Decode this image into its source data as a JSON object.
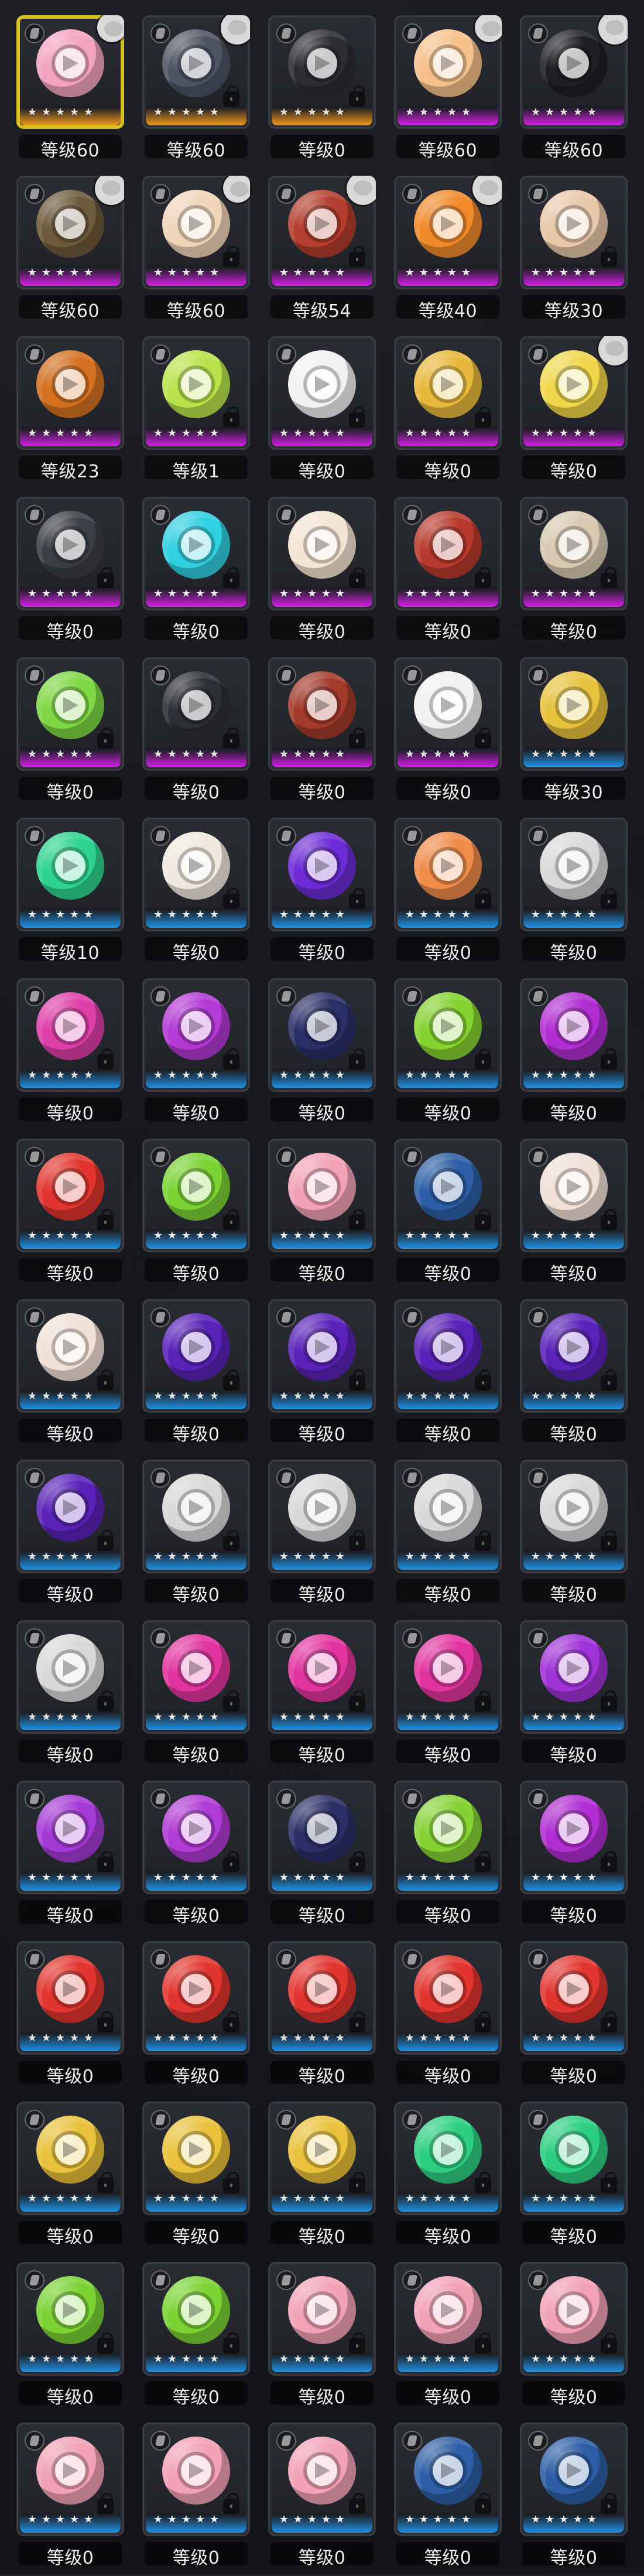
{
  "grid": {
    "columns": 5,
    "items": [
      {
        "level_text": "等级60",
        "tier_color": "#f39a1c",
        "ball_color": "#f3a3bf",
        "has_portrait": true,
        "locked": false,
        "selected": true,
        "stars": 5
      },
      {
        "level_text": "等级60",
        "tier_color": "#f39a1c",
        "ball_color": "#4d5563",
        "has_portrait": true,
        "locked": true,
        "selected": false,
        "stars": 5
      },
      {
        "level_text": "等级0",
        "tier_color": "#f39a1c",
        "ball_color": "#2b2d33",
        "has_portrait": false,
        "locked": true,
        "selected": false,
        "stars": 5
      },
      {
        "level_text": "等级60",
        "tier_color": "#d51ee8",
        "ball_color": "#f6c08b",
        "has_portrait": true,
        "locked": false,
        "selected": false,
        "stars": 5
      },
      {
        "level_text": "等级60",
        "tier_color": "#d51ee8",
        "ball_color": "#1e1f23",
        "has_portrait": true,
        "locked": false,
        "selected": false,
        "stars": 5
      },
      {
        "level_text": "等级60",
        "tier_color": "#d51ee8",
        "ball_color": "#6c5a3a",
        "has_portrait": true,
        "locked": false,
        "selected": false,
        "stars": 5
      },
      {
        "level_text": "等级60",
        "tier_color": "#d51ee8",
        "ball_color": "#f0d4b8",
        "has_portrait": true,
        "locked": true,
        "selected": false,
        "stars": 5
      },
      {
        "level_text": "等级54",
        "tier_color": "#d51ee8",
        "ball_color": "#b33d2e",
        "has_portrait": true,
        "locked": true,
        "selected": false,
        "stars": 5
      },
      {
        "level_text": "等级40",
        "tier_color": "#d51ee8",
        "ball_color": "#f08a2b",
        "has_portrait": true,
        "locked": false,
        "selected": false,
        "stars": 5
      },
      {
        "level_text": "等级30",
        "tier_color": "#d51ee8",
        "ball_color": "#e9c7a9",
        "has_portrait": false,
        "locked": true,
        "selected": false,
        "stars": 5
      },
      {
        "level_text": "等级23",
        "tier_color": "#d51ee8",
        "ball_color": "#d47020",
        "has_portrait": false,
        "locked": false,
        "selected": false,
        "stars": 5
      },
      {
        "level_text": "等级1",
        "tier_color": "#d51ee8",
        "ball_color": "#b9e24a",
        "has_portrait": false,
        "locked": true,
        "selected": false,
        "stars": 5
      },
      {
        "level_text": "等级0",
        "tier_color": "#d51ee8",
        "ball_color": "#f1f1f1",
        "has_portrait": false,
        "locked": true,
        "selected": false,
        "stars": 5
      },
      {
        "level_text": "等级0",
        "tier_color": "#d51ee8",
        "ball_color": "#e7b83b",
        "has_portrait": false,
        "locked": true,
        "selected": false,
        "stars": 5
      },
      {
        "level_text": "等级0",
        "tier_color": "#d51ee8",
        "ball_color": "#f0d64a",
        "has_portrait": true,
        "locked": false,
        "selected": false,
        "stars": 5
      },
      {
        "level_text": "等级0",
        "tier_color": "#d51ee8",
        "ball_color": "#3b3e45",
        "has_portrait": false,
        "locked": true,
        "selected": false,
        "stars": 5
      },
      {
        "level_text": "等级0",
        "tier_color": "#d51ee8",
        "ball_color": "#2fd0e0",
        "has_portrait": false,
        "locked": true,
        "selected": false,
        "stars": 5
      },
      {
        "level_text": "等级0",
        "tier_color": "#d51ee8",
        "ball_color": "#f4e4d3",
        "has_portrait": false,
        "locked": true,
        "selected": false,
        "stars": 5
      },
      {
        "level_text": "等级0",
        "tier_color": "#d51ee8",
        "ball_color": "#b83a2e",
        "has_portrait": false,
        "locked": true,
        "selected": false,
        "stars": 5
      },
      {
        "level_text": "等级0",
        "tier_color": "#d51ee8",
        "ball_color": "#d8c8b0",
        "has_portrait": false,
        "locked": true,
        "selected": false,
        "stars": 5
      },
      {
        "level_text": "等级0",
        "tier_color": "#d51ee8",
        "ball_color": "#7ed744",
        "has_portrait": false,
        "locked": true,
        "selected": false,
        "stars": 5
      },
      {
        "level_text": "等级0",
        "tier_color": "#d51ee8",
        "ball_color": "#2c2f36",
        "has_portrait": false,
        "locked": true,
        "selected": false,
        "stars": 5
      },
      {
        "level_text": "等级0",
        "tier_color": "#d51ee8",
        "ball_color": "#a23a2b",
        "has_portrait": false,
        "locked": true,
        "selected": false,
        "stars": 5
      },
      {
        "level_text": "等级0",
        "tier_color": "#d51ee8",
        "ball_color": "#f1f1f1",
        "has_portrait": false,
        "locked": true,
        "selected": false,
        "stars": 5
      },
      {
        "level_text": "等级30",
        "tier_color": "#1f92e6",
        "ball_color": "#e7c23d",
        "has_portrait": false,
        "locked": false,
        "selected": false,
        "stars": 5
      },
      {
        "level_text": "等级10",
        "tier_color": "#1f92e6",
        "ball_color": "#2ed38f",
        "has_portrait": false,
        "locked": false,
        "selected": false,
        "stars": 5
      },
      {
        "level_text": "等级0",
        "tier_color": "#1f92e6",
        "ball_color": "#f0e8de",
        "has_portrait": false,
        "locked": true,
        "selected": false,
        "stars": 5
      },
      {
        "level_text": "等级0",
        "tier_color": "#1f92e6",
        "ball_color": "#6d2bd5",
        "has_portrait": false,
        "locked": true,
        "selected": false,
        "stars": 5
      },
      {
        "level_text": "等级0",
        "tier_color": "#1f92e6",
        "ball_color": "#f08b4a",
        "has_portrait": false,
        "locked": true,
        "selected": false,
        "stars": 5
      },
      {
        "level_text": "等级0",
        "tier_color": "#1f92e6",
        "ball_color": "#d9d9d9",
        "has_portrait": false,
        "locked": true,
        "selected": false,
        "stars": 5
      },
      {
        "level_text": "等级0",
        "tier_color": "#1f92e6",
        "ball_color": "#de3ea8",
        "has_portrait": false,
        "locked": true,
        "selected": false,
        "stars": 5
      },
      {
        "level_text": "等级0",
        "tier_color": "#1f92e6",
        "ball_color": "#b33ad4",
        "has_portrait": false,
        "locked": true,
        "selected": false,
        "stars": 5
      },
      {
        "level_text": "等级0",
        "tier_color": "#1f92e6",
        "ball_color": "#2a2f67",
        "has_portrait": false,
        "locked": true,
        "selected": false,
        "stars": 5
      },
      {
        "level_text": "等级0",
        "tier_color": "#1f92e6",
        "ball_color": "#85d230",
        "has_portrait": false,
        "locked": true,
        "selected": false,
        "stars": 5
      },
      {
        "level_text": "等级0",
        "tier_color": "#1f92e6",
        "ball_color": "#b12ed2",
        "has_portrait": false,
        "locked": true,
        "selected": false,
        "stars": 5
      },
      {
        "level_text": "等级0",
        "tier_color": "#1f92e6",
        "ball_color": "#e2352f",
        "has_portrait": false,
        "locked": true,
        "selected": false,
        "stars": 5
      },
      {
        "level_text": "等级0",
        "tier_color": "#1f92e6",
        "ball_color": "#7ad233",
        "has_portrait": false,
        "locked": true,
        "selected": false,
        "stars": 5
      },
      {
        "level_text": "等级0",
        "tier_color": "#1f92e6",
        "ball_color": "#f2a1b6",
        "has_portrait": false,
        "locked": true,
        "selected": false,
        "stars": 5
      },
      {
        "level_text": "等级0",
        "tier_color": "#1f92e6",
        "ball_color": "#2d5ea5",
        "has_portrait": false,
        "locked": true,
        "selected": false,
        "stars": 5
      },
      {
        "level_text": "等级0",
        "tier_color": "#1f92e6",
        "ball_color": "#f0e0d6",
        "has_portrait": false,
        "locked": true,
        "selected": false,
        "stars": 5
      },
      {
        "level_text": "等级0",
        "tier_color": "#1f92e6",
        "ball_color": "#f0e0d6",
        "has_portrait": false,
        "locked": true,
        "selected": false,
        "stars": 5
      },
      {
        "level_text": "等级0",
        "tier_color": "#1f92e6",
        "ball_color": "#5a22b8",
        "has_portrait": false,
        "locked": true,
        "selected": false,
        "stars": 5
      },
      {
        "level_text": "等级0",
        "tier_color": "#1f92e6",
        "ball_color": "#5a22b8",
        "has_portrait": false,
        "locked": true,
        "selected": false,
        "stars": 5
      },
      {
        "level_text": "等级0",
        "tier_color": "#1f92e6",
        "ball_color": "#5a22b8",
        "has_portrait": false,
        "locked": true,
        "selected": false,
        "stars": 5
      },
      {
        "level_text": "等级0",
        "tier_color": "#1f92e6",
        "ball_color": "#5a22b8",
        "has_portrait": false,
        "locked": true,
        "selected": false,
        "stars": 5
      },
      {
        "level_text": "等级0",
        "tier_color": "#1f92e6",
        "ball_color": "#5a22b8",
        "has_portrait": false,
        "locked": true,
        "selected": false,
        "stars": 5
      },
      {
        "level_text": "等级0",
        "tier_color": "#1f92e6",
        "ball_color": "#d8d8d8",
        "has_portrait": false,
        "locked": true,
        "selected": false,
        "stars": 5
      },
      {
        "level_text": "等级0",
        "tier_color": "#1f92e6",
        "ball_color": "#d8d8d8",
        "has_portrait": false,
        "locked": true,
        "selected": false,
        "stars": 5
      },
      {
        "level_text": "等级0",
        "tier_color": "#1f92e6",
        "ball_color": "#d8d8d8",
        "has_portrait": false,
        "locked": true,
        "selected": false,
        "stars": 5
      },
      {
        "level_text": "等级0",
        "tier_color": "#1f92e6",
        "ball_color": "#d8d8d8",
        "has_portrait": false,
        "locked": true,
        "selected": false,
        "stars": 5
      },
      {
        "level_text": "等级0",
        "tier_color": "#1f92e6",
        "ball_color": "#d8d8d8",
        "has_portrait": false,
        "locked": true,
        "selected": false,
        "stars": 5
      },
      {
        "level_text": "等级0",
        "tier_color": "#1f92e6",
        "ball_color": "#e2349f",
        "has_portrait": false,
        "locked": true,
        "selected": false,
        "stars": 5
      },
      {
        "level_text": "等级0",
        "tier_color": "#1f92e6",
        "ball_color": "#e2349f",
        "has_portrait": false,
        "locked": true,
        "selected": false,
        "stars": 5
      },
      {
        "level_text": "等级0",
        "tier_color": "#1f92e6",
        "ball_color": "#e2349f",
        "has_portrait": false,
        "locked": true,
        "selected": false,
        "stars": 5
      },
      {
        "level_text": "等级0",
        "tier_color": "#1f92e6",
        "ball_color": "#a032d8",
        "has_portrait": false,
        "locked": true,
        "selected": false,
        "stars": 5
      },
      {
        "level_text": "等级0",
        "tier_color": "#1f92e6",
        "ball_color": "#a43ad6",
        "has_portrait": false,
        "locked": true,
        "selected": false,
        "stars": 5
      },
      {
        "level_text": "等级0",
        "tier_color": "#1f92e6",
        "ball_color": "#b13bd5",
        "has_portrait": false,
        "locked": true,
        "selected": false,
        "stars": 5
      },
      {
        "level_text": "等级0",
        "tier_color": "#1f92e6",
        "ball_color": "#2a2f67",
        "has_portrait": false,
        "locked": true,
        "selected": false,
        "stars": 5
      },
      {
        "level_text": "等级0",
        "tier_color": "#1f92e6",
        "ball_color": "#86d235",
        "has_portrait": false,
        "locked": true,
        "selected": false,
        "stars": 5
      },
      {
        "level_text": "等级0",
        "tier_color": "#1f92e6",
        "ball_color": "#b12ed2",
        "has_portrait": false,
        "locked": true,
        "selected": false,
        "stars": 5
      },
      {
        "level_text": "等级0",
        "tier_color": "#1f92e6",
        "ball_color": "#e2352f",
        "has_portrait": false,
        "locked": true,
        "selected": false,
        "stars": 5
      },
      {
        "level_text": "等级0",
        "tier_color": "#1f92e6",
        "ball_color": "#e2352f",
        "has_portrait": false,
        "locked": true,
        "selected": false,
        "stars": 5
      },
      {
        "level_text": "等级0",
        "tier_color": "#1f92e6",
        "ball_color": "#e2352f",
        "has_portrait": false,
        "locked": true,
        "selected": false,
        "stars": 5
      },
      {
        "level_text": "等级0",
        "tier_color": "#1f92e6",
        "ball_color": "#e2352f",
        "has_portrait": false,
        "locked": true,
        "selected": false,
        "stars": 5
      },
      {
        "level_text": "等级0",
        "tier_color": "#1f92e6",
        "ball_color": "#e2352f",
        "has_portrait": false,
        "locked": true,
        "selected": false,
        "stars": 5
      },
      {
        "level_text": "等级0",
        "tier_color": "#1f92e6",
        "ball_color": "#e9c13a",
        "has_portrait": false,
        "locked": true,
        "selected": false,
        "stars": 5
      },
      {
        "level_text": "等级0",
        "tier_color": "#1f92e6",
        "ball_color": "#e9c13a",
        "has_portrait": false,
        "locked": true,
        "selected": false,
        "stars": 5
      },
      {
        "level_text": "等级0",
        "tier_color": "#1f92e6",
        "ball_color": "#e9c13a",
        "has_portrait": false,
        "locked": true,
        "selected": false,
        "stars": 5
      },
      {
        "level_text": "等级0",
        "tier_color": "#1f92e6",
        "ball_color": "#2ccf80",
        "has_portrait": false,
        "locked": true,
        "selected": false,
        "stars": 5
      },
      {
        "level_text": "等级0",
        "tier_color": "#1f92e6",
        "ball_color": "#2ccf80",
        "has_portrait": false,
        "locked": true,
        "selected": false,
        "stars": 5
      },
      {
        "level_text": "等级0",
        "tier_color": "#1f92e6",
        "ball_color": "#7ad233",
        "has_portrait": false,
        "locked": true,
        "selected": false,
        "stars": 5
      },
      {
        "level_text": "等级0",
        "tier_color": "#1f92e6",
        "ball_color": "#7ad233",
        "has_portrait": false,
        "locked": true,
        "selected": false,
        "stars": 5
      },
      {
        "level_text": "等级0",
        "tier_color": "#1f92e6",
        "ball_color": "#f2a1b6",
        "has_portrait": false,
        "locked": true,
        "selected": false,
        "stars": 5
      },
      {
        "level_text": "等级0",
        "tier_color": "#1f92e6",
        "ball_color": "#f2a1b6",
        "has_portrait": false,
        "locked": true,
        "selected": false,
        "stars": 5
      },
      {
        "level_text": "等级0",
        "tier_color": "#1f92e6",
        "ball_color": "#f2a1b6",
        "has_portrait": false,
        "locked": true,
        "selected": false,
        "stars": 5
      },
      {
        "level_text": "等级0",
        "tier_color": "#1f92e6",
        "ball_color": "#f2a1b6",
        "has_portrait": false,
        "locked": true,
        "selected": false,
        "stars": 5
      },
      {
        "level_text": "等级0",
        "tier_color": "#1f92e6",
        "ball_color": "#f2a1b6",
        "has_portrait": false,
        "locked": true,
        "selected": false,
        "stars": 5
      },
      {
        "level_text": "等级0",
        "tier_color": "#1f92e6",
        "ball_color": "#f2a1b6",
        "has_portrait": false,
        "locked": true,
        "selected": false,
        "stars": 5
      },
      {
        "level_text": "等级0",
        "tier_color": "#1f92e6",
        "ball_color": "#2d5ea5",
        "has_portrait": false,
        "locked": true,
        "selected": false,
        "stars": 5
      },
      {
        "level_text": "等级0",
        "tier_color": "#1f92e6",
        "ball_color": "#2d5ea5",
        "has_portrait": false,
        "locked": true,
        "selected": false,
        "stars": 5
      }
    ]
  }
}
